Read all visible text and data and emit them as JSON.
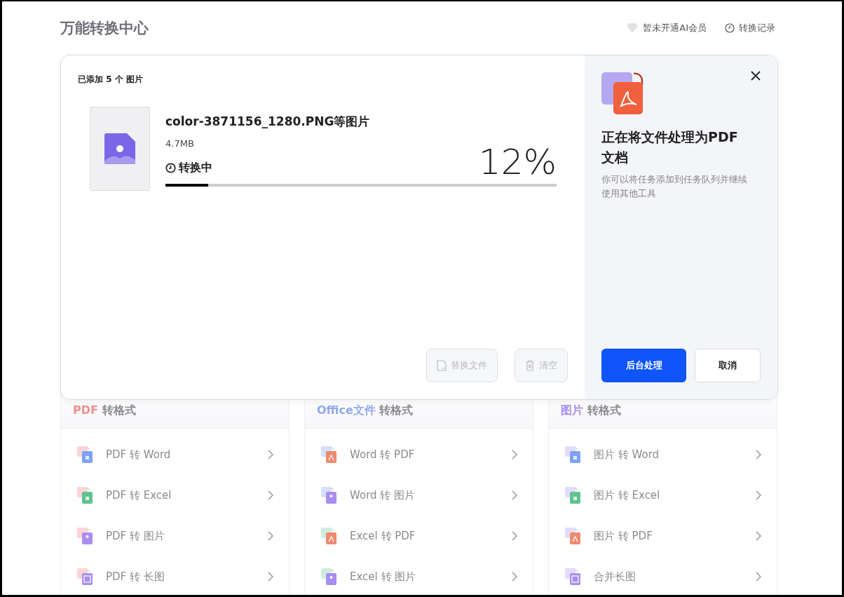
{
  "header": {
    "title": "万能转换中心",
    "links": [
      {
        "kind": "vip",
        "label": "暂未开通AI会员"
      },
      {
        "kind": "history",
        "label": "转换记录"
      }
    ]
  },
  "dialog": {
    "added": {
      "before": "已添加",
      "count": "5",
      "after": "个 图片"
    },
    "file": {
      "name": "color-3871156_1280.PNG等图片",
      "size": "4.7MB",
      "status": "转换中",
      "percent": "12%",
      "level": 0.11
    },
    "actions": [
      {
        "label": "替换文件",
        "kind": "replace",
        "disabled": true
      },
      {
        "label": "清空",
        "kind": "clear",
        "disabled": true
      }
    ],
    "side": {
      "title": "正在将文件处理为PDF文档",
      "subtitle": "你可以将任务添加到任务队列并继续使用其他工具",
      "primary": "后台处理",
      "secondary": "取消"
    }
  },
  "groups": [
    {
      "prefix": "PDF",
      "title": "转格式",
      "color": "#f08f8f",
      "items": [
        {
          "label": "PDF 转 Word",
          "kind": "word",
          "color": "#fbd5d5"
        },
        {
          "label": "PDF 转 Excel",
          "kind": "excel",
          "color": "#fbd5d5"
        },
        {
          "label": "PDF 转 图片",
          "kind": "image",
          "color": "#fbd5d5"
        },
        {
          "label": "PDF 转 长图",
          "kind": "long",
          "color": "#fbd5d5"
        }
      ]
    },
    {
      "prefix": "Office文件",
      "title": "转格式",
      "color": "#8fa8f0",
      "items": [
        {
          "label": "Word 转 PDF",
          "kind": "pdf",
          "color": "#d6e0fb"
        },
        {
          "label": "Word 转 图片",
          "kind": "image",
          "color": "#d6e0fb"
        },
        {
          "label": "Excel 转 PDF",
          "kind": "pdf",
          "color": "#cfeedd"
        },
        {
          "label": "Excel 转 图片",
          "kind": "image",
          "color": "#cfeedd"
        }
      ]
    },
    {
      "prefix": "图片",
      "title": "转格式",
      "color": "#a58ee8",
      "items": [
        {
          "label": "图片 转 Word",
          "kind": "word",
          "color": "#e3dcfa"
        },
        {
          "label": "图片 转 Excel",
          "kind": "excel",
          "color": "#e3dcfa"
        },
        {
          "label": "图片 转 PDF",
          "kind": "pdf",
          "color": "#e3dcfa"
        },
        {
          "label": "合并长图",
          "kind": "long",
          "color": "#e3dcfa"
        }
      ]
    }
  ]
}
